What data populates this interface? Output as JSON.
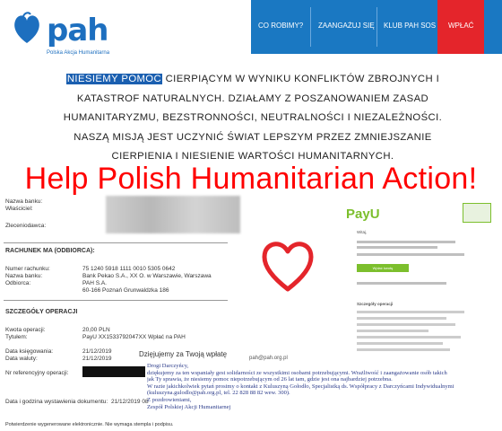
{
  "header": {
    "logo_text": "pah",
    "logo_subtitle": "Polska Akcja Humanitarna",
    "nav": [
      {
        "label": "CO ROBIMY?"
      },
      {
        "label": "ZAANGAŻUJ SIĘ"
      },
      {
        "label": "KLUB PAH SOS"
      }
    ],
    "donate_label": "WPŁAĆ"
  },
  "mission": {
    "highlight": "NIESIEMY POMOC",
    "rest": " CIERPIĄCYM W WYNIKU KONFLIKTÓW ZBROJNYCH I KATASTROF NATURALNYCH. DZIAŁAMY Z POSZANOWANIEM ZASAD HUMANITARYZMU, BEZSTRONNOŚCI, NEUTRALNOŚCI I NIEZALEŻNOŚCI. NASZĄ MISJĄ JEST UCZYNIĆ ŚWIAT LEPSZYM PRZEZ ZMNIEJSZANIE CIERPIENIA I NIESIENIE WARTOŚCI HUMANITARNYCH."
  },
  "headline": "Help Polish Humanitarian Action!",
  "bank_doc": {
    "labels_top": [
      "Nazwa banku:",
      "Właściciel:",
      "Zleceniodawca:"
    ],
    "section_recipient": "RACHUNEK MA (ODBIORCA):",
    "account_label": "Numer rachunku:",
    "account_value": "75 1240 5918 1111 0010 5305 0642",
    "bank_label": "Nazwa banku:",
    "bank_value": "Bank Pekao S.A., XX O. w Warszawie, Warszawa",
    "recipient_label": "Odbiorca:",
    "recipient_value_1": "PAH S.A.",
    "recipient_value_2": "60-166 Poznań Grunwaldzka 186",
    "section_details": "SZCZEGÓŁY OPERACJI",
    "amount_label": "Kwota operacji:",
    "amount_value": "20,00 PLN",
    "title_label": "Tytułem:",
    "title_value": "PayU XX1533792047XX Wpłać na PAH",
    "book_label": "Data księgowania:",
    "book_value": "21/12/2019",
    "currency_label": "Data waluty:",
    "currency_value": "21/12/2019",
    "ref_label": "Nr referencyjny operacji:",
    "issue_label": "Data i godzina wystawienia dokumentu:",
    "issue_value": "21/12/2019 08",
    "footer": "Potwierdzenie wygenerowane elektronicznie. Nie wymaga stempla i podpisu."
  },
  "thanks": "Dzięjujemy za Twoją wpłatę",
  "payu": {
    "logo": "PayU",
    "greeting": "Witaj,",
    "pay_button": "Wpłać kwotę",
    "ops_header": "Szczegóły operacji"
  },
  "email_from": "pah@pah.org.pl",
  "letter": [
    "Drogi Darczyńcy,",
    "dziękujemy za ten wspaniały gest solidarności ze wszystkimi osobami potrzebującymi. Wrażliwość i zaangażowanie osób takich",
    "jak Ty sprawia, że niesiemy pomoc niepotrzebującym od 26 lat tam, gdzie jest ona najbardziej potrzebna.",
    "W razie jakichkolwiek pytań prosimy o kontakt z Kuluszyną Gołodło, Specjalistką ds. Współpracy z Darczyńcami Indywidualnymi",
    "(kuluszyna.gulodlo@pah.org.pl, tel. 22 828 88 82 wew. 300).",
    "Z pozdrowieniami,",
    "Zespół Polskiej Akcji Humanitarnej"
  ],
  "colors": {
    "brand_blue": "#1a78c2",
    "donate_red": "#e4252b",
    "headline_red": "#ff0000",
    "payu_green": "#7cbf2d"
  }
}
